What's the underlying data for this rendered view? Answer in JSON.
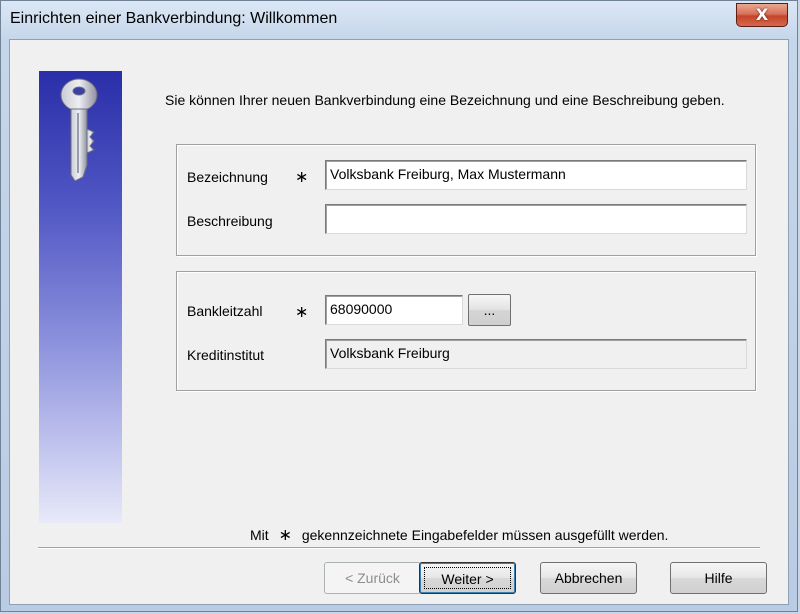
{
  "window": {
    "title": "Einrichten einer Bankverbindung: Willkommen",
    "close_label": "X"
  },
  "intro_text": "Sie können Ihrer neuen Bankverbindung eine Bezeichnung und eine Beschreibung geben.",
  "required_marker": "∗",
  "group1": {
    "bezeichnung_label": "Bezeichnung",
    "bezeichnung_value": "Volksbank Freiburg, Max Mustermann",
    "beschreibung_label": "Beschreibung",
    "beschreibung_value": ""
  },
  "group2": {
    "blz_label": "Bankleitzahl",
    "blz_value": "68090000",
    "browse_label": "...",
    "institut_label": "Kreditinstitut",
    "institut_value": "Volksbank Freiburg"
  },
  "footnote": {
    "prefix": "Mit",
    "marker": "∗",
    "suffix": "gekennzeichnete Eingabefelder müssen ausgefüllt werden."
  },
  "buttons": {
    "back": "< Zurück",
    "next": "Weiter >",
    "cancel": "Abbrechen",
    "help": "Hilfe"
  },
  "icons": {
    "side_icon": "key-icon",
    "close_icon": "close-icon"
  }
}
